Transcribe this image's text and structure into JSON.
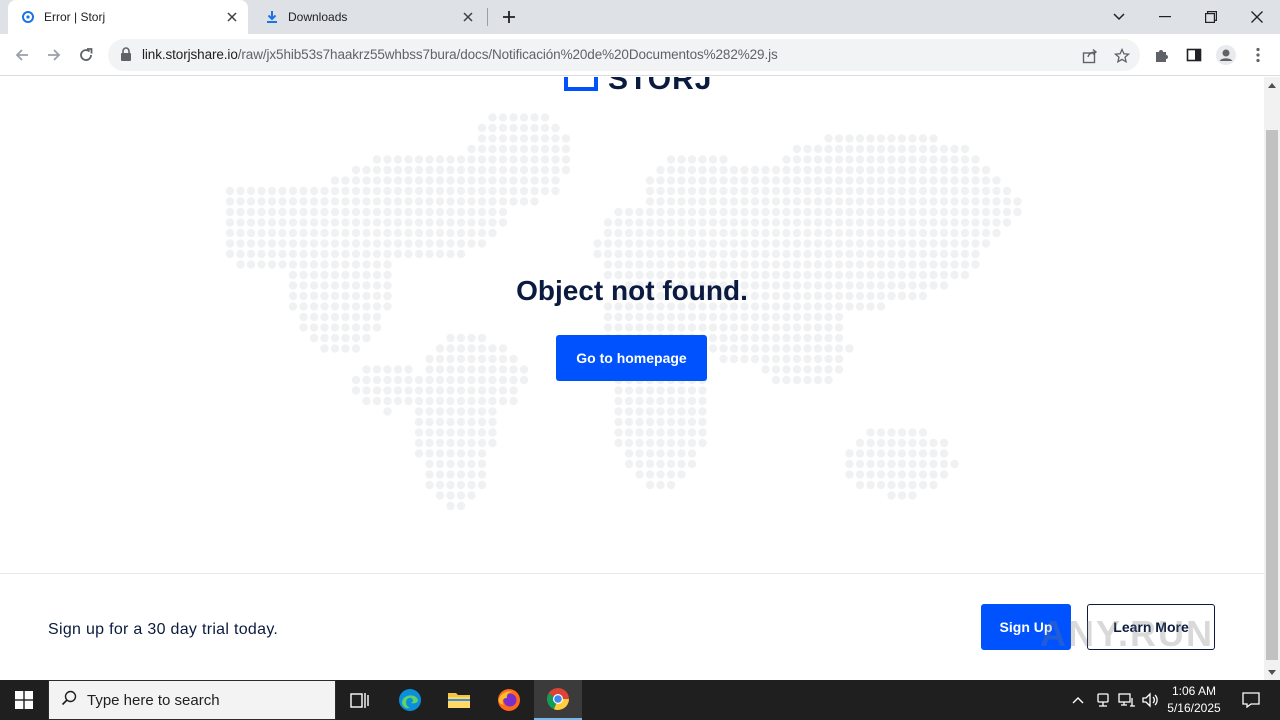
{
  "browser": {
    "tabs": [
      {
        "title": "Error | Storj",
        "active": true,
        "icon": "storj-favicon-icon"
      },
      {
        "title": "Downloads",
        "active": false,
        "icon": "download-icon"
      }
    ],
    "url_host": "link.storjshare.io",
    "url_path": "/raw/jx5hib53s7haakrz55whbss7bura/docs/Notificación%20de%20Documentos%282%29.js"
  },
  "page": {
    "logo_text": "STORJ",
    "headline": "Object not found.",
    "home_button": "Go to homepage",
    "cta_text": "Sign up for a 30 day trial today.",
    "signup_button": "Sign Up",
    "learn_button": "Learn More",
    "watermark": "ANY.RUN"
  },
  "taskbar": {
    "search_placeholder": "Type here to search",
    "time": "1:06 AM",
    "date": "5/16/2025"
  },
  "colors": {
    "brand_blue": "#0052ff",
    "navy": "#0b1b3f",
    "map_dot": "#f0f1f3"
  }
}
